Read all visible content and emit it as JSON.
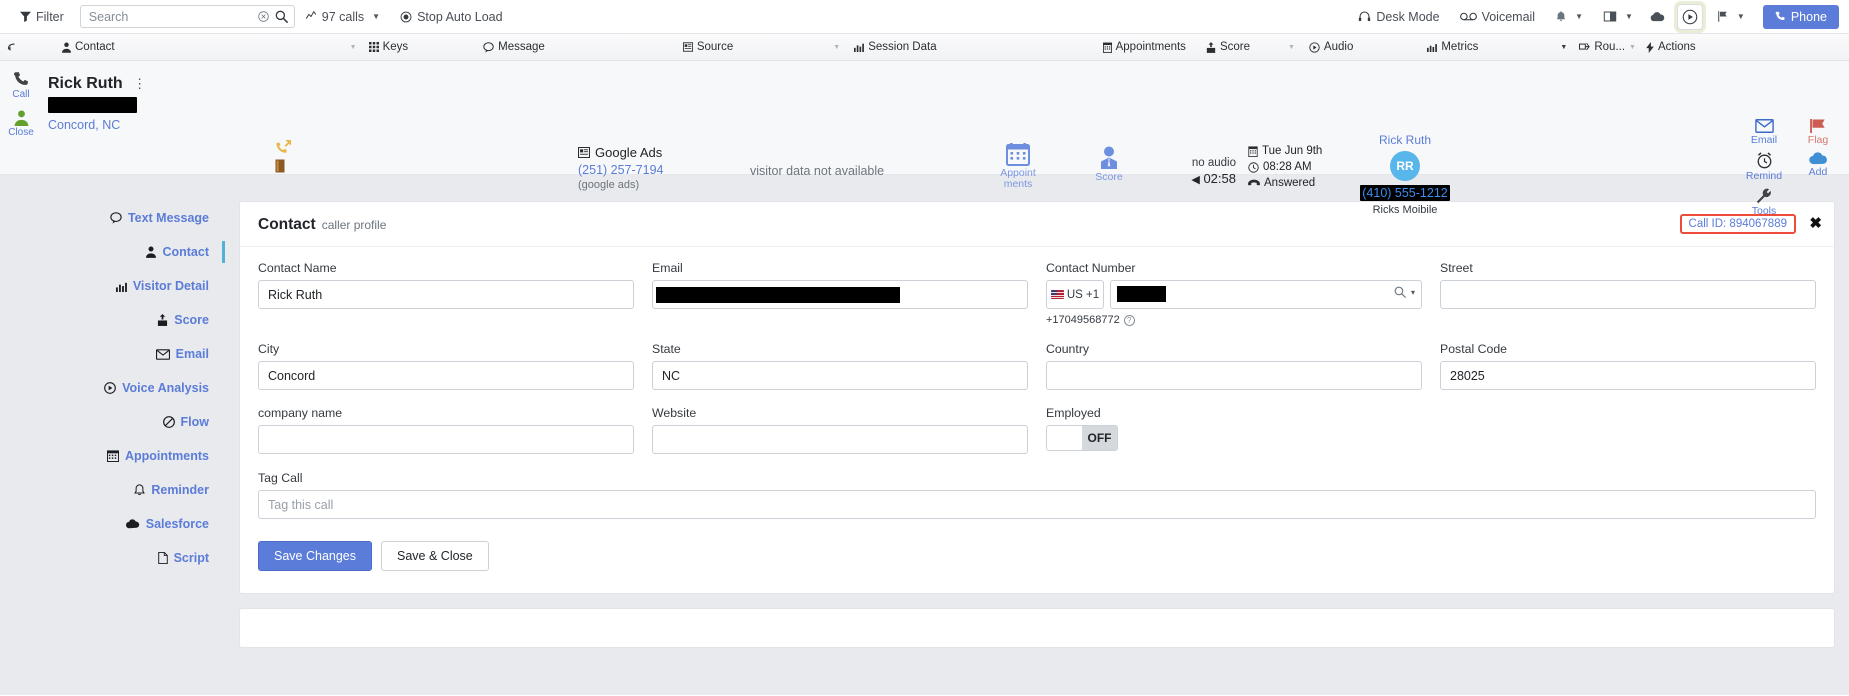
{
  "topbar": {
    "filter_label": "Filter",
    "search_placeholder": "Search",
    "calls_label": "97 calls",
    "autoload_label": "Stop Auto Load",
    "desk_mode_label": "Desk Mode",
    "voicemail_label": "Voicemail",
    "phone_label": "Phone",
    "accent": "#5b7cd8"
  },
  "nav": {
    "tabs": [
      {
        "label": "Contact",
        "icon": "person-icon",
        "caret": true
      },
      {
        "label": "Keys",
        "icon": "keypad-icon",
        "caret": false
      },
      {
        "label": "Message",
        "icon": "comment-icon",
        "caret": false
      },
      {
        "label": "Source",
        "icon": "source-icon",
        "caret": true
      },
      {
        "label": "Session Data",
        "icon": "chart-icon",
        "caret": false
      },
      {
        "label": "Appointments",
        "icon": "calendar-icon",
        "caret": false
      },
      {
        "label": "Score",
        "icon": "score-icon",
        "caret": true
      },
      {
        "label": "Audio",
        "icon": "play-circle-icon",
        "caret": false
      },
      {
        "label": "Metrics",
        "icon": "metrics-icon",
        "caret": true
      },
      {
        "label": "Rou...",
        "icon": "route-icon",
        "caret": true
      },
      {
        "label": "Actions",
        "icon": "bolt-icon",
        "caret": false
      }
    ]
  },
  "call_header": {
    "actions": [
      {
        "label": "Call",
        "icon": "phone-icon"
      },
      {
        "label": "Close",
        "icon": "person-icon"
      }
    ],
    "contact_name": "Rick Ruth",
    "contact_phone_redacted": "(410) 555-1212",
    "location": "Concord, NC",
    "source_title": "Google Ads",
    "source_number": "(251) 257-7194",
    "source_sub": "(google ads)",
    "visitor_data": "visitor data not available",
    "appointments_label": "Appoint\nments",
    "appointments_label_1": "Appoint",
    "appointments_label_2": "ments",
    "score_label": "Score",
    "audio_status": "no audio",
    "audio_duration": "02:58",
    "date": "Tue Jun 9th",
    "time": "08:28 AM",
    "status": "Answered",
    "agent_name": "Rick Ruth",
    "agent_initials": "RR",
    "agent_phone_redacted": "(410) 555-1212",
    "agent_device": "Ricks Moibile",
    "tools": [
      {
        "label": "Email",
        "icon": "envelope-icon"
      },
      {
        "label": "Flag",
        "icon": "flag-icon"
      },
      {
        "label": "Remind",
        "icon": "alarm-clock-icon"
      },
      {
        "label": "Add",
        "icon": "cloud-icon"
      },
      {
        "label": "Tools",
        "icon": "wrench-icon"
      }
    ]
  },
  "sidebar": {
    "items": [
      {
        "label": "Text Message",
        "icon": "comment-icon",
        "active": false
      },
      {
        "label": "Contact",
        "icon": "person-icon",
        "active": true
      },
      {
        "label": "Visitor Detail",
        "icon": "bar-chart-icon",
        "active": false
      },
      {
        "label": "Score",
        "icon": "score-icon",
        "active": false
      },
      {
        "label": "Email",
        "icon": "envelope-icon",
        "active": false
      },
      {
        "label": "Voice Analysis",
        "icon": "play-circle-icon",
        "active": false
      },
      {
        "label": "Flow",
        "icon": "ban-icon",
        "active": false
      },
      {
        "label": "Appointments",
        "icon": "calendar-icon",
        "active": false
      },
      {
        "label": "Reminder",
        "icon": "bell-icon",
        "active": false
      },
      {
        "label": "Salesforce",
        "icon": "cloud-icon",
        "active": false
      },
      {
        "label": "Script",
        "icon": "file-icon",
        "active": false
      }
    ]
  },
  "contact_card": {
    "title": "Contact",
    "subtitle": "caller profile",
    "call_id_label": "Call ID: 894067889",
    "call_id_border": "#ef4b3a",
    "fields": {
      "contact_name": {
        "label": "Contact Name",
        "value": "Rick Ruth",
        "placeholder": ""
      },
      "email": {
        "label": "Email",
        "value": "",
        "placeholder": ""
      },
      "contact_number": {
        "label": "Contact Number",
        "value": "",
        "placeholder": "",
        "country": "US +1",
        "hint": "+17049568772"
      },
      "street": {
        "label": "Street",
        "value": "",
        "placeholder": ""
      },
      "city": {
        "label": "City",
        "value": "Concord",
        "placeholder": ""
      },
      "state": {
        "label": "State",
        "value": "NC",
        "placeholder": ""
      },
      "country": {
        "label": "Country",
        "value": "",
        "placeholder": ""
      },
      "postal_code": {
        "label": "Postal Code",
        "value": "28025",
        "placeholder": ""
      },
      "company_name": {
        "label": "company name",
        "value": "",
        "placeholder": ""
      },
      "website": {
        "label": "Website",
        "value": "",
        "placeholder": ""
      },
      "employed": {
        "label": "Employed",
        "state": "OFF"
      },
      "tag_call": {
        "label": "Tag Call",
        "value": "",
        "placeholder": "Tag this call"
      }
    },
    "buttons": {
      "save_changes": "Save Changes",
      "save_close": "Save & Close"
    }
  }
}
